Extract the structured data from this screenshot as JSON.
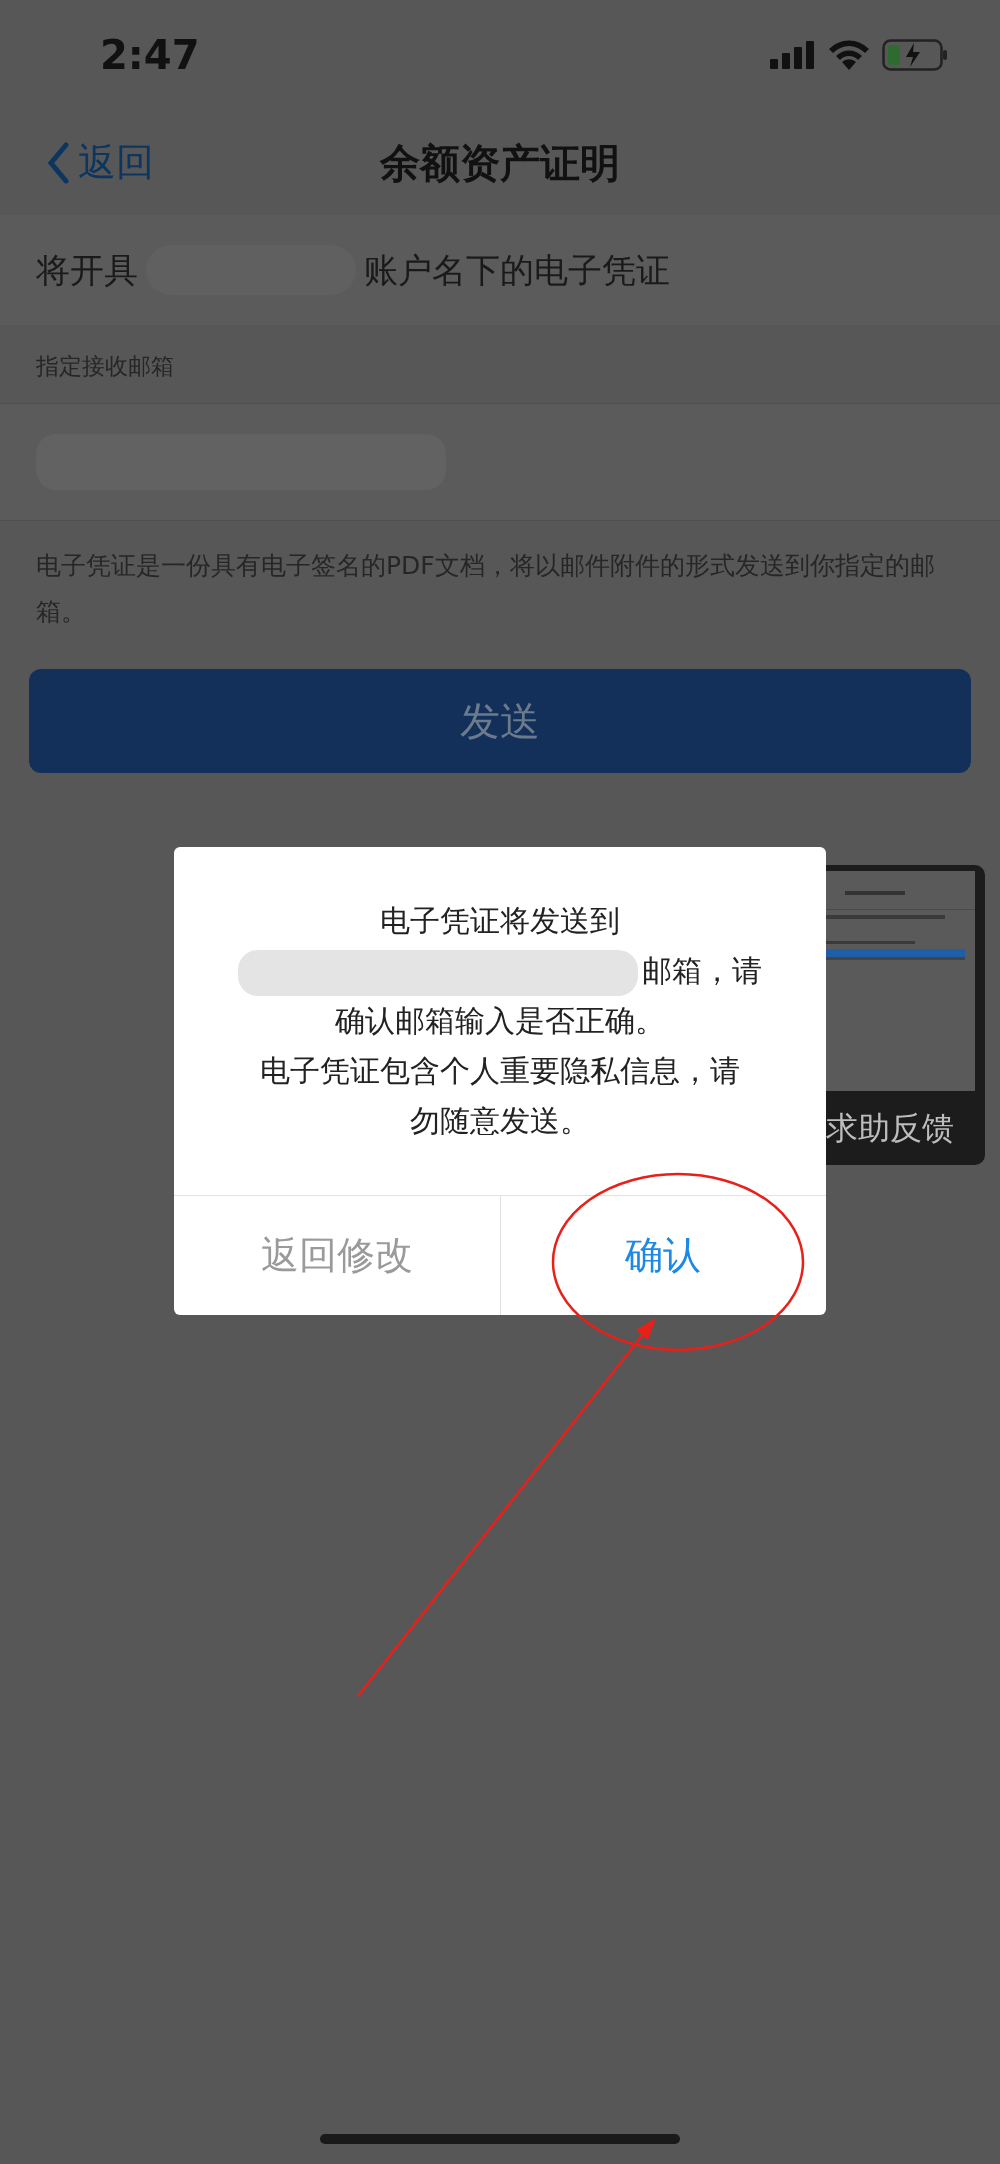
{
  "status_bar": {
    "time": "2:47"
  },
  "nav": {
    "back": "返回",
    "title": "余额资产证明"
  },
  "account_row": {
    "prefix": "将开具",
    "suffix": "账户名下的电子凭证"
  },
  "email_label": "指定接收邮箱",
  "note": "电子凭证是一份具有电子签名的PDF文档，将以邮件附件的形式发送到你指定的邮箱。",
  "send_button": "发送",
  "feedback_thumbnail": {
    "label": "求助反馈"
  },
  "dialog": {
    "message_lines": [
      {
        "text": "电子凭证将发送到",
        "redacted": false
      },
      {
        "text": "邮箱，请",
        "redacted": true
      },
      {
        "text": "确认邮箱输入是否正确。",
        "redacted": false
      },
      {
        "text": "电子凭证包含个人重要隐私信息，请",
        "redacted": false
      },
      {
        "text": "勿随意发送。",
        "redacted": false
      }
    ],
    "buttons": [
      {
        "label": "返回修改",
        "kind": "cancel"
      },
      {
        "label": "确认",
        "kind": "confirm"
      }
    ]
  }
}
